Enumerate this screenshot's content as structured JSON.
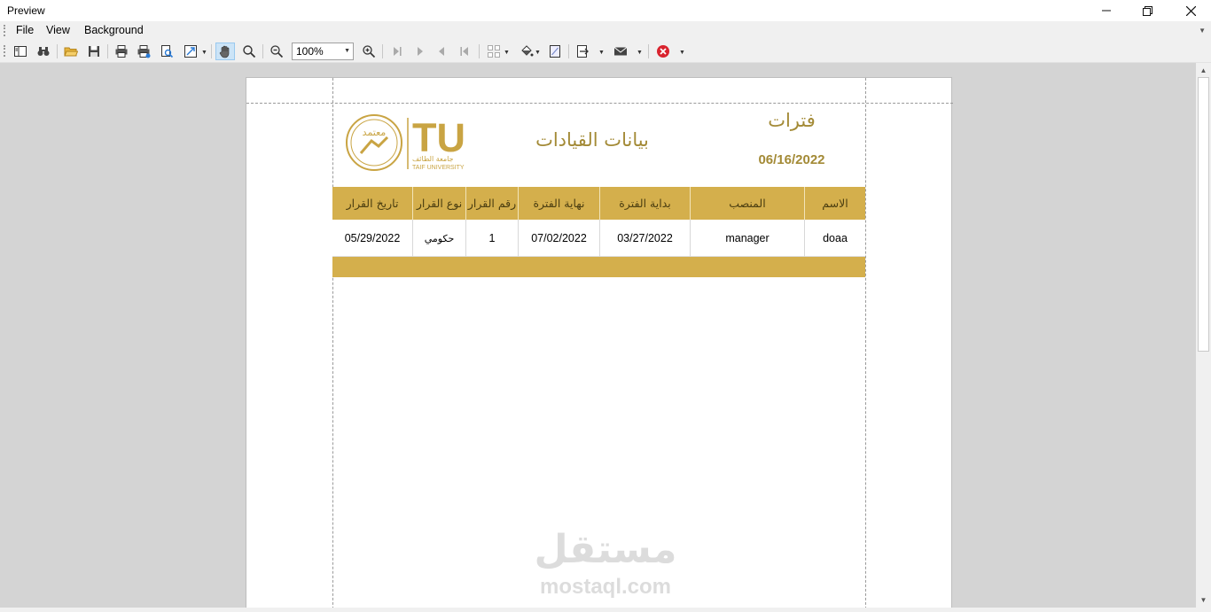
{
  "window": {
    "title": "Preview"
  },
  "menu": {
    "items": [
      "File",
      "View",
      "Background"
    ]
  },
  "toolbar": {
    "zoom": "100%"
  },
  "report": {
    "title": "بيانات القيادات",
    "subtitle": "فترات",
    "date": "06/16/2022",
    "logo_text": "TU",
    "logo_caption": "TAIF UNIVERSITY",
    "logo_arabic": "جامعة الطائف",
    "seal_text": "معتمد",
    "headers": [
      "تاريخ القرار",
      "نوع القرار",
      "رقم القرار",
      "نهاية الفترة",
      "بداية الفترة",
      "المنصب",
      "الاسم"
    ],
    "rows": [
      [
        "05/29/2022",
        "حكومي",
        "1",
        "07/02/2022",
        "03/27/2022",
        "manager",
        "doaa"
      ]
    ]
  },
  "watermark": {
    "arabic": "مستقل",
    "latin": "mostaql.com"
  },
  "colors": {
    "gold": "#d4af4c",
    "gold_text": "#a38a36"
  }
}
